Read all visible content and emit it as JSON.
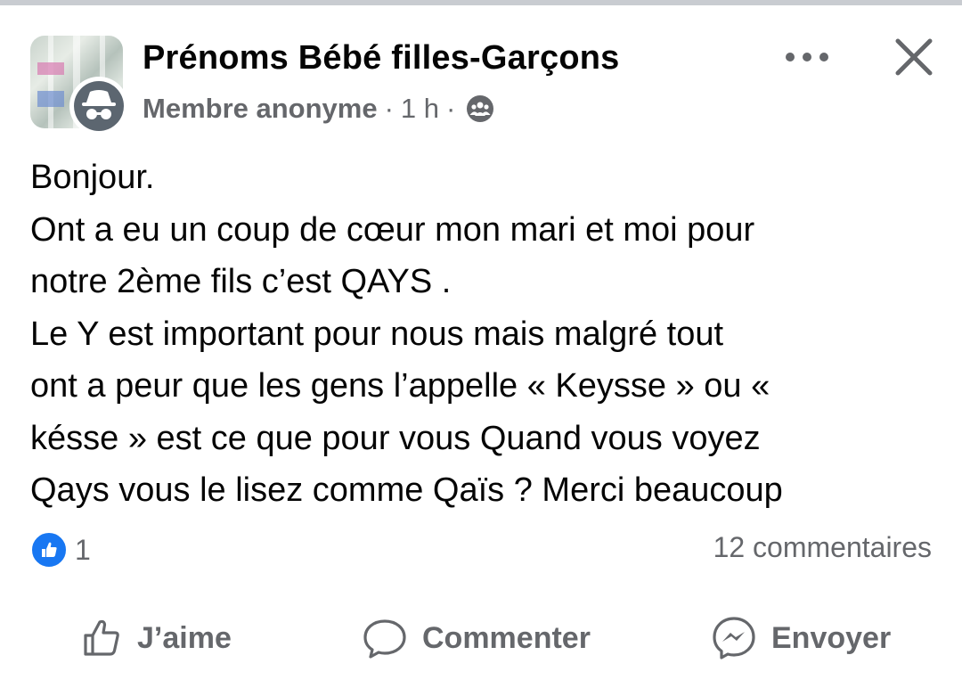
{
  "header": {
    "group_name": "Prénoms  Bébé filles-Garçons",
    "author": "Membre anonyme",
    "dot": "·",
    "time": "1 h",
    "audience_icon": "group-icon",
    "more_icon": "more-horizontal-icon",
    "close_icon": "close-icon"
  },
  "post": {
    "lines": [
      "Bonjour.",
      "Ont a eu un coup de cœur mon mari et moi pour",
      "notre 2ème fils c’est QAYS .",
      "Le Y est important pour nous mais malgré tout",
      "ont a peur que les gens l’appelle « Keysse » ou «",
      "késse » est ce que pour vous Quand vous voyez",
      "Qays vous le lisez comme Qaïs ? Merci beaucoup"
    ]
  },
  "stats": {
    "reaction_count": "1",
    "comments": "12 commentaires"
  },
  "actions": {
    "like": "J’aime",
    "comment": "Commenter",
    "send": "Envoyer"
  },
  "colors": {
    "text": "#050505",
    "secondary": "#65676b",
    "like_blue": "#1877f2"
  }
}
